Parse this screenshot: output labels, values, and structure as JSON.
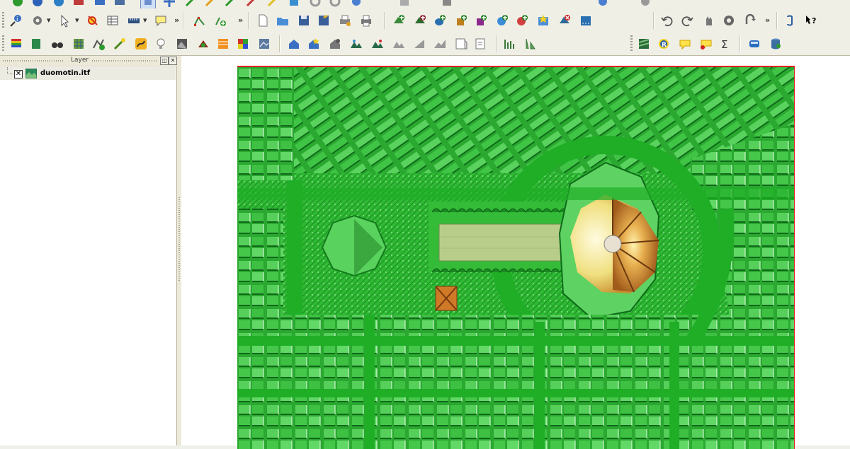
{
  "toolbars": {
    "row0_icons": [
      "add-vector-layer-icon",
      "add-raster-layer-icon",
      "add-postgis-icon",
      "add-spatialite-icon",
      "add-wms-icon",
      "add-wfs-icon",
      "select-tool-icon",
      "move-feature-icon",
      "node-tool-icon",
      "split-features-icon",
      "merge-features-icon",
      "digitize-icon",
      "rotate-icon",
      "simplify-icon",
      "add-ring-icon",
      "delete-ring-icon",
      "reshape-icon",
      "offset-curve-icon",
      "georeferencer-icon",
      "gps-tool-icon",
      "plugin-icon"
    ],
    "row1_icons": [
      "identify-icon",
      "action-gear-icon",
      "select-features-icon",
      "deselect-icon",
      "attribute-table-icon",
      "measure-icon",
      "map-tips-icon",
      "node-editor-icon",
      "add-node-icon",
      "new-project-icon",
      "open-project-icon",
      "save-project-icon",
      "save-as-icon",
      "print-composer-icon",
      "print-icon",
      "add-vector-icon",
      "add-raster-icon",
      "add-postgis-layer-icon",
      "add-spatialite-layer-icon",
      "add-mssql-icon",
      "add-wms-layer-icon",
      "add-oracle-icon",
      "new-shapefile-icon",
      "remove-layer-icon",
      "save-edits-icon",
      "undo-icon",
      "redo-icon",
      "pan-icon",
      "zoom-icon",
      "rotate-view-icon",
      "python-console-icon",
      "help-whats-this-icon"
    ],
    "row2_icons": [
      "raster-legend-icon",
      "raster-calc-icon",
      "binoculars-icon",
      "raster-grid-icon",
      "vector-edit-icon",
      "magic-wand-icon",
      "bezier-icon",
      "info-bulb-icon",
      "dem-hillshade-icon",
      "dem-slope-icon",
      "dem-aspect-icon",
      "color-relief-icon",
      "raster-info-icon",
      "house-3d-icon",
      "star-3d-icon",
      "building-3d-icon",
      "terrain-3d-icon",
      "terrain-3d-b-icon",
      "mountain-icon",
      "profile-icon",
      "profile-b-icon",
      "profile-c-icon",
      "grass-tools-icon",
      "vertical-bars-icon",
      "chart-bars-icon",
      "grass-module-icon",
      "r-script-icon",
      "annotation-icon",
      "annotation-b-icon",
      "sum-icon",
      "train-icon",
      "database-icon"
    ]
  },
  "layer_panel": {
    "title": "Layer",
    "float_button": "◫",
    "close_button": "✕",
    "layers": [
      {
        "name": "duomotin.itf",
        "visible": true,
        "check_mark": "✕"
      }
    ]
  },
  "colors": {
    "map_background": "#28b62f",
    "extent_border": "#e0201c",
    "cathedral_dome": "#c87826"
  }
}
